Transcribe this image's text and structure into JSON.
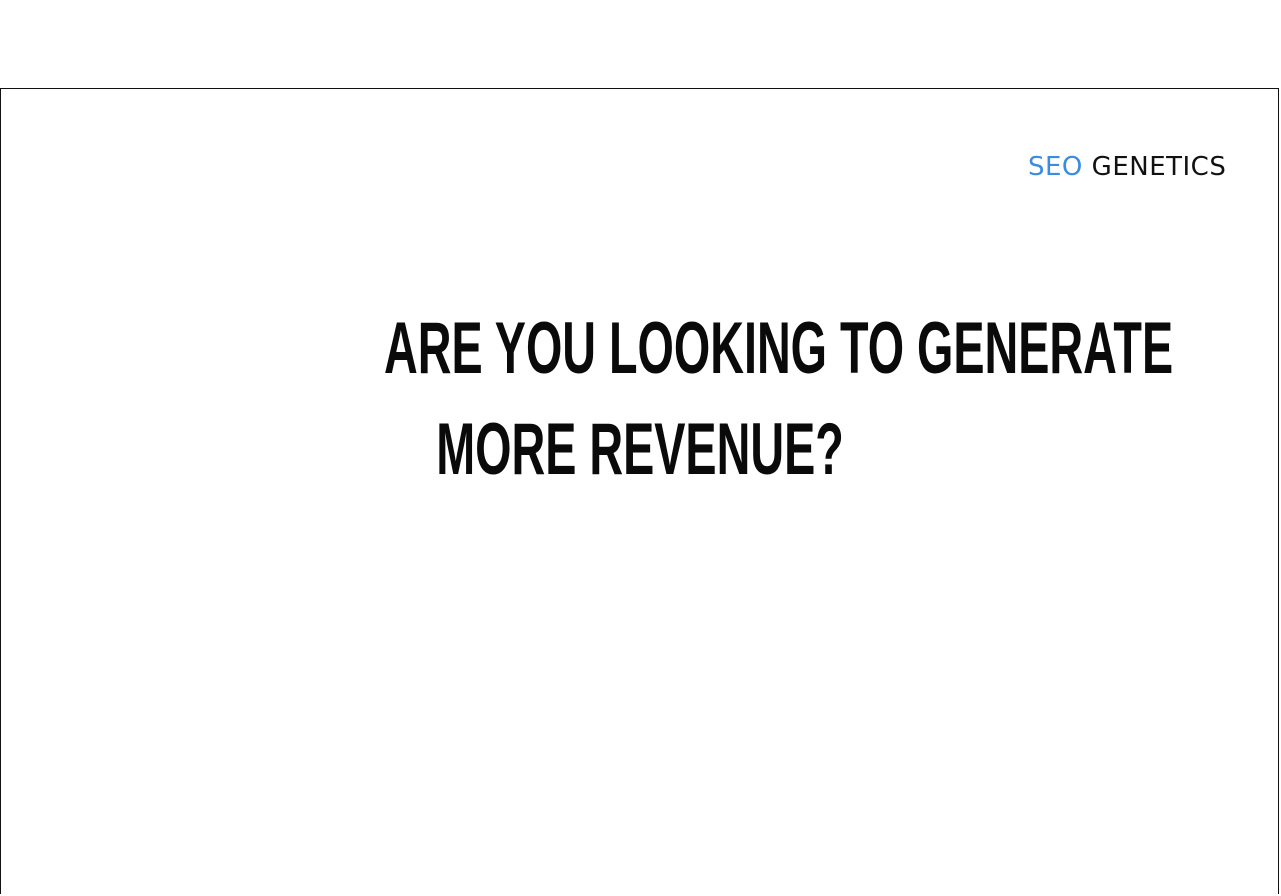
{
  "logo": {
    "part1": "SEO",
    "part2": "GENETICS",
    "accent_color": "#3b8be0",
    "text_color": "#111111"
  },
  "hero": {
    "line1": "ARE YOU LOOKING TO GENERATE",
    "line2": "MORE REVENUE?"
  }
}
